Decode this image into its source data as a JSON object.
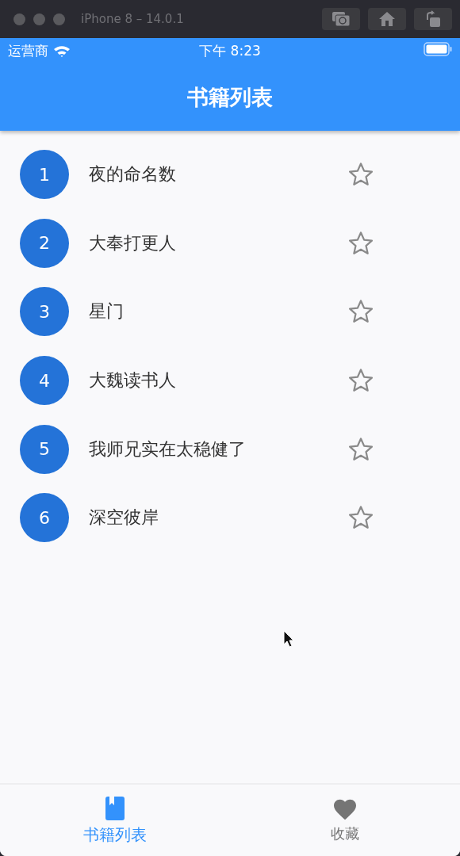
{
  "window": {
    "title": "iPhone 8 – 14.0.1"
  },
  "status_bar": {
    "carrier": "运营商",
    "time": "下午 8:23"
  },
  "app_bar": {
    "title": "书籍列表"
  },
  "books": [
    {
      "index": "1",
      "title": "夜的命名数",
      "favorite": false
    },
    {
      "index": "2",
      "title": "大奉打更人",
      "favorite": false
    },
    {
      "index": "3",
      "title": "星门",
      "favorite": false
    },
    {
      "index": "4",
      "title": "大魏读书人",
      "favorite": false
    },
    {
      "index": "5",
      "title": "我师兄实在太稳健了",
      "favorite": false
    },
    {
      "index": "6",
      "title": "深空彼岸",
      "favorite": false
    }
  ],
  "tabs": [
    {
      "kind": "book",
      "label": "书籍列表",
      "selected": true
    },
    {
      "kind": "heart",
      "label": "收藏",
      "selected": false
    }
  ]
}
